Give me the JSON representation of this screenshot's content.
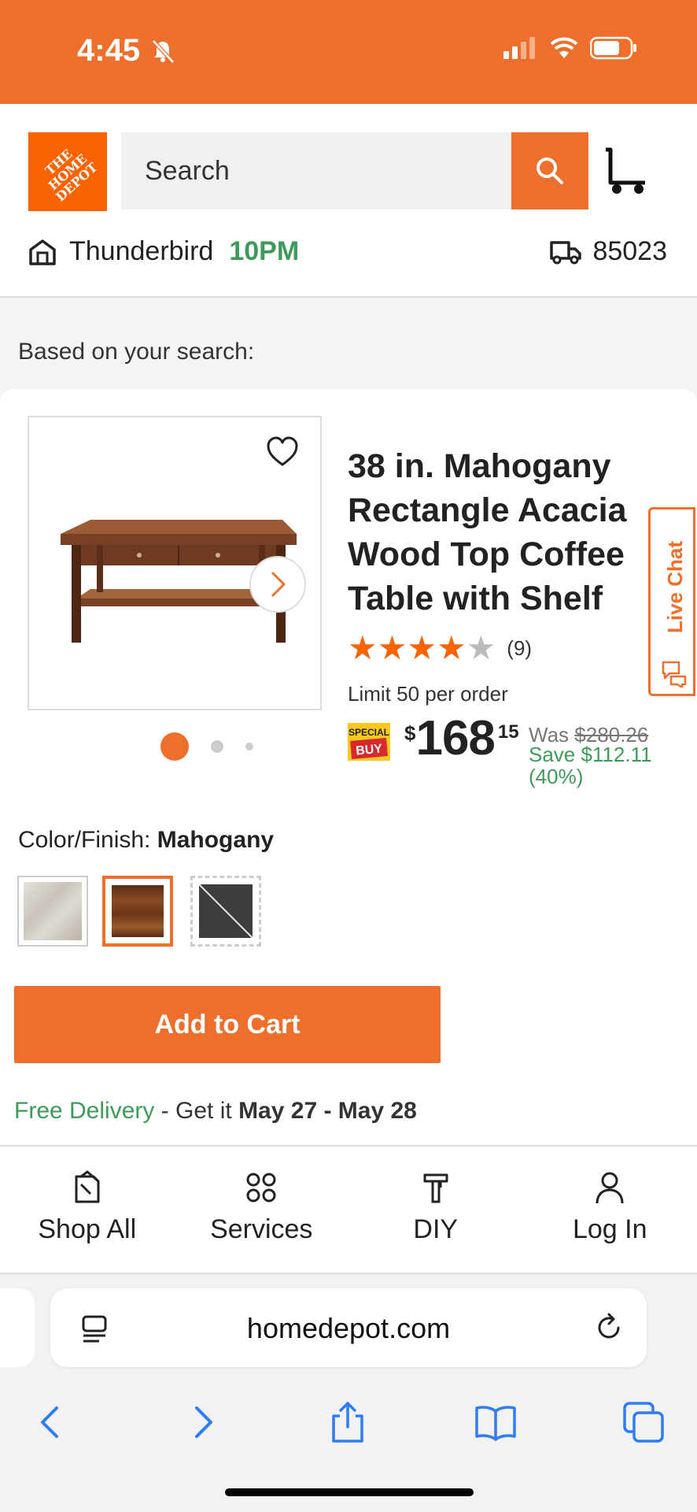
{
  "status_bar": {
    "time": "4:45"
  },
  "header": {
    "logo_text": "THE HOME DEPOT",
    "search_placeholder": "Search",
    "store_name": "Thunderbird",
    "store_hours": "10PM",
    "zip": "85023"
  },
  "main": {
    "based_on": "Based on your search:",
    "product": {
      "title": "38 in. Mahogany Rectangle Acacia Wood Top Coffee Table with Shelf",
      "rating": 4,
      "rating_max": 5,
      "review_count": "(9)",
      "limit": "Limit 50 per order",
      "special_buy_top": "SPECIAL",
      "special_buy_bottom": "BUY",
      "price_dollar_sign": "$",
      "price_main": "168",
      "price_cents": "15",
      "was_label": "Was",
      "was_price": "$280.26",
      "save_line": "Save $112.11",
      "save_percent": "(40%)",
      "image_index": 1,
      "image_count": 3
    },
    "color_finish": {
      "label": "Color/Finish:",
      "selected": "Mahogany",
      "swatch_colors": [
        "#d8d4ce",
        "#6b3a1f",
        "#3d3d3d"
      ]
    },
    "add_to_cart": "Add to Cart",
    "delivery": {
      "free": "Free Delivery",
      "middle": " - Get it ",
      "dates": "May 27 - May 28"
    },
    "live_chat": "Live Chat"
  },
  "bottom_nav": {
    "items": [
      {
        "label": "Shop All",
        "icon": "shop-all-icon"
      },
      {
        "label": "Services",
        "icon": "services-icon"
      },
      {
        "label": "DIY",
        "icon": "diy-icon"
      },
      {
        "label": "Log In",
        "icon": "user-icon"
      }
    ]
  },
  "browser": {
    "url": "homedepot.com"
  },
  "colors": {
    "brand": "#ee6f2c",
    "green": "#3e9a5a",
    "link_blue": "#2f7cf6"
  }
}
